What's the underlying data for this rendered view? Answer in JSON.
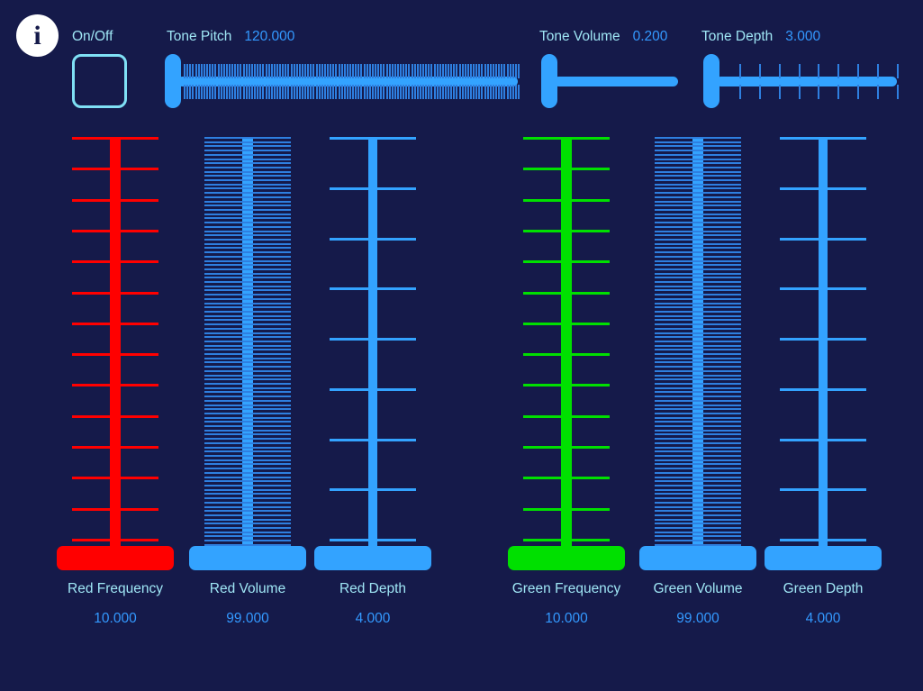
{
  "app": {
    "background_color": "#151a4a",
    "accent_blue": "#33a3ff",
    "label_color": "#9fe6f5",
    "value_color": "#3399ff",
    "red_color": "#ff0000",
    "green_color": "#00e000"
  },
  "header": {
    "info_icon": "info-icon",
    "info_glyph": "i",
    "onoff": {
      "label": "On/Off",
      "checked": false
    },
    "controls": [
      {
        "name": "tone-pitch",
        "label": "Tone Pitch",
        "value": "120.000",
        "numeric": 120.0,
        "ticks": 120,
        "fill_ratio": 1.0
      },
      {
        "name": "tone-volume",
        "label": "Tone Volume",
        "value": "0.200",
        "numeric": 0.2,
        "ticks": 0,
        "fill_ratio": 1.0
      },
      {
        "name": "tone-depth",
        "label": "Tone Depth",
        "value": "3.000",
        "numeric": 3.0,
        "ticks": 9,
        "fill_ratio": 1.0
      }
    ]
  },
  "sliders": [
    {
      "name": "red-frequency",
      "label": "Red Frequency",
      "value": "10.000",
      "numeric": 10.0,
      "color": "#ff0000",
      "track_width": 12,
      "ticks": 14,
      "tick_thickness": 3
    },
    {
      "name": "red-volume",
      "label": "Red Volume",
      "value": "99.000",
      "numeric": 99.0,
      "color": "#33a3ff",
      "tick_color": "#2e7fe0",
      "track_width": 12,
      "ticks": 99,
      "tick_thickness": 2
    },
    {
      "name": "red-depth",
      "label": "Red Depth",
      "value": "4.000",
      "numeric": 4.0,
      "color": "#33a3ff",
      "track_width": 10,
      "ticks": 9,
      "tick_thickness": 3
    },
    {
      "name": "green-frequency",
      "label": "Green Frequency",
      "value": "10.000",
      "numeric": 10.0,
      "color": "#00e000",
      "track_width": 12,
      "ticks": 14,
      "tick_thickness": 3
    },
    {
      "name": "green-volume",
      "label": "Green Volume",
      "value": "99.000",
      "numeric": 99.0,
      "color": "#33a3ff",
      "tick_color": "#2e7fe0",
      "track_width": 12,
      "ticks": 99,
      "tick_thickness": 2
    },
    {
      "name": "green-depth",
      "label": "Green Depth",
      "value": "4.000",
      "numeric": 4.0,
      "color": "#33a3ff",
      "track_width": 10,
      "ticks": 9,
      "tick_thickness": 3
    }
  ]
}
